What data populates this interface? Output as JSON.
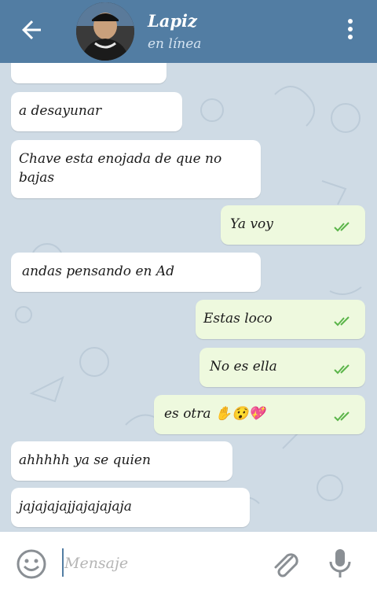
{
  "header": {
    "contact_name": "Lapiz",
    "status": "en línea",
    "back_icon": "arrow-left-icon",
    "menu_icon": "more-vertical-icon"
  },
  "messages": [
    {
      "side": "in",
      "text": "a desayunar"
    },
    {
      "side": "in",
      "text": "Chave esta enojada de que no bajas"
    },
    {
      "side": "out",
      "text": "Ya voy",
      "read": true
    },
    {
      "side": "in",
      "text": "andas pensando en Ad"
    },
    {
      "side": "out",
      "text": "Estas loco",
      "read": true
    },
    {
      "side": "out",
      "text": "No es ella",
      "read": true
    },
    {
      "side": "out",
      "text": "es otra ✋😯💖",
      "read": true
    },
    {
      "side": "in",
      "text": "ahhhhh ya se quien"
    },
    {
      "side": "in",
      "text": "jajajajajjajajajaja"
    }
  ],
  "composer": {
    "placeholder": "Mensaje",
    "emoji_icon": "smile-icon",
    "attach_icon": "paperclip-icon",
    "mic_icon": "microphone-icon"
  },
  "colors": {
    "header": "#527da3",
    "chat_bg": "#cfdbe5",
    "outgoing": "#eef9de",
    "incoming": "#ffffff",
    "checks": "#5bb54a"
  }
}
